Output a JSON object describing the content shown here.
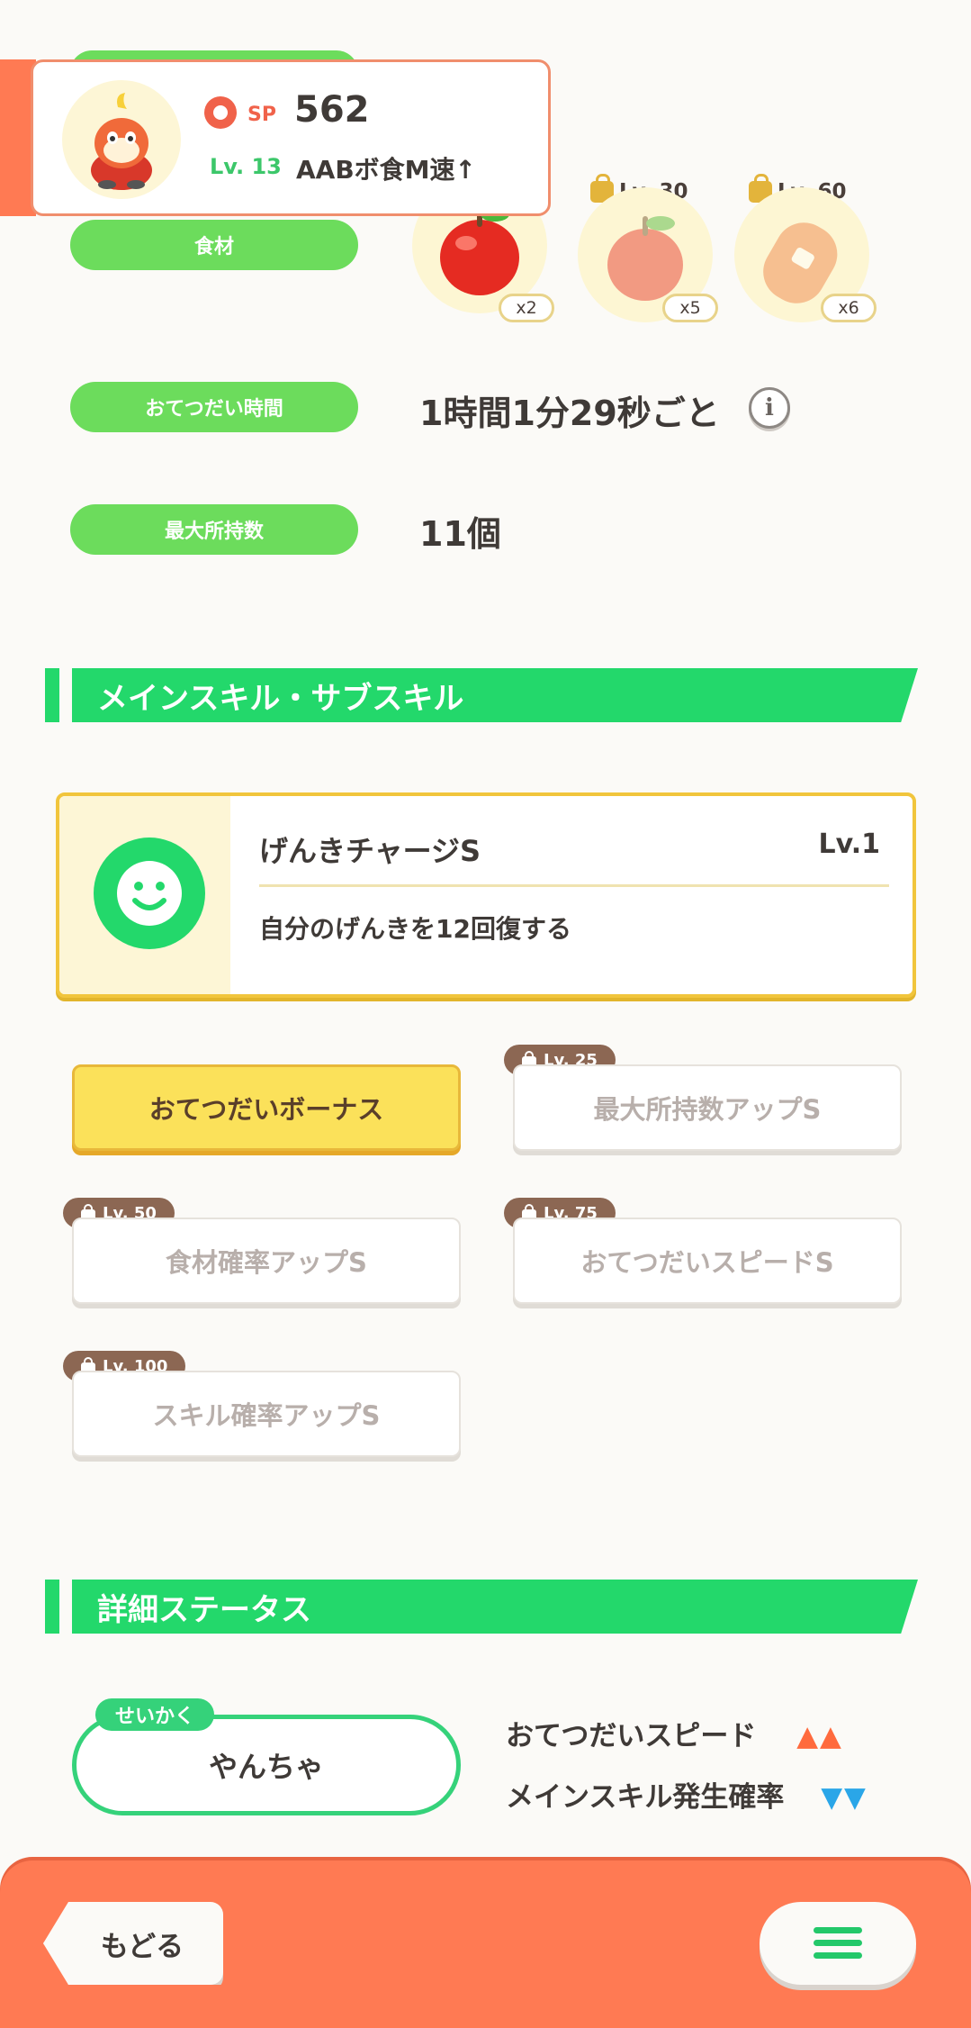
{
  "header": {
    "sp_label": "SP",
    "sp_value": "562",
    "level": "Lv. 13",
    "nickname": "AABボ食M速↑"
  },
  "ingredients": {
    "label": "食材",
    "items": [
      {
        "count": "x2",
        "locked": false,
        "lock_level": "",
        "name": "apple-icon"
      },
      {
        "count": "x5",
        "locked": true,
        "lock_level": "Lv. 30",
        "name": "apple-faded-icon"
      },
      {
        "count": "x6",
        "locked": true,
        "lock_level": "Lv. 60",
        "name": "sausage-icon"
      }
    ]
  },
  "help_time": {
    "label": "おてつだい時間",
    "value": "1時間1分29秒ごと"
  },
  "max_carry": {
    "label": "最大所持数",
    "value": "11個"
  },
  "skills_section": {
    "title": "メインスキル・サブスキル"
  },
  "main_skill": {
    "name": "げんきチャージS",
    "level": "Lv.1",
    "description": "自分のげんきを12回復する"
  },
  "sub_skills": [
    {
      "label": "おてつだいボーナス",
      "lock_level": "",
      "active": true
    },
    {
      "label": "最大所持数アップS",
      "lock_level": "Lv. 25",
      "active": false
    },
    {
      "label": "食材確率アップS",
      "lock_level": "Lv. 50",
      "active": false
    },
    {
      "label": "おてつだいスピードS",
      "lock_level": "Lv. 75",
      "active": false
    },
    {
      "label": "スキル確率アップS",
      "lock_level": "Lv. 100",
      "active": false
    }
  ],
  "details_section": {
    "title": "詳細ステータス"
  },
  "nature": {
    "tag": "せいかく",
    "value": "やんちゃ",
    "up_stat": "おてつだいスピード",
    "down_stat": "メインスキル発生確率",
    "up_arrows": "▲▲",
    "down_arrows": "▼▼",
    "up_color": "#ff6a3d",
    "down_color": "#2aa6e8"
  },
  "footer": {
    "back_label": "もどる"
  },
  "colors": {
    "accent_green": "#23d86b",
    "footer": "#ff7a53",
    "pill": "#6cdc5c"
  }
}
